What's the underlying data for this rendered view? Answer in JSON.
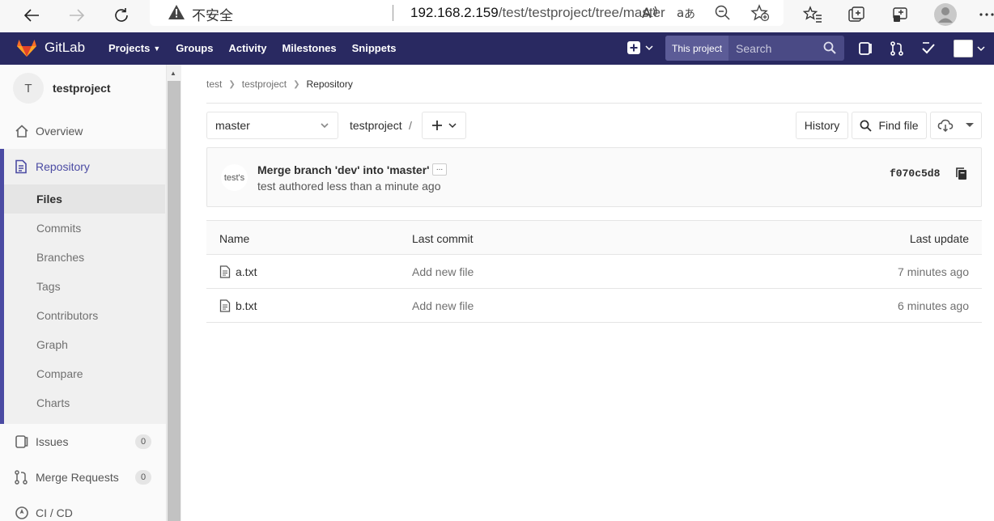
{
  "browser": {
    "insecure_label": "不安全",
    "url_host": "192.168.2.159",
    "url_path": "/test/testproject/tree/master",
    "read_aloud_label": "Á̆",
    "translate_label": "aあ"
  },
  "header": {
    "brand": "GitLab",
    "nav": {
      "projects": "Projects",
      "groups": "Groups",
      "activity": "Activity",
      "milestones": "Milestones",
      "snippets": "Snippets"
    },
    "search_scope": "This project",
    "search_placeholder": "Search"
  },
  "sidebar": {
    "project_initial": "T",
    "project_name": "testproject",
    "overview": "Overview",
    "repository": "Repository",
    "sub_items": {
      "files": "Files",
      "commits": "Commits",
      "branches": "Branches",
      "tags": "Tags",
      "contributors": "Contributors",
      "graph": "Graph",
      "compare": "Compare",
      "charts": "Charts"
    },
    "issues": "Issues",
    "issues_count": "0",
    "merge_requests": "Merge Requests",
    "merge_requests_count": "0",
    "cicd": "CI / CD"
  },
  "breadcrumb": {
    "group": "test",
    "project": "testproject",
    "current": "Repository"
  },
  "toolbar": {
    "branch": "master",
    "path": "testproject",
    "path_slash": "/",
    "history": "History",
    "find_file": "Find file"
  },
  "commit": {
    "avatar_alt": "test's",
    "title": "Merge branch 'dev' into 'master'",
    "ellipsis": "...",
    "meta": "test authored less than a minute ago",
    "sha": "f070c5d8"
  },
  "tree": {
    "headers": {
      "name": "Name",
      "last_commit": "Last commit",
      "last_update": "Last update"
    },
    "rows": [
      {
        "name": "a.txt",
        "commit": "Add new file",
        "updated": "7 minutes ago"
      },
      {
        "name": "b.txt",
        "commit": "Add new file",
        "updated": "6 minutes ago"
      }
    ]
  },
  "colors": {
    "header_bg": "#292961",
    "sidebar_active_border": "#4b4ba3",
    "gitlab_orange": "#e24329"
  }
}
